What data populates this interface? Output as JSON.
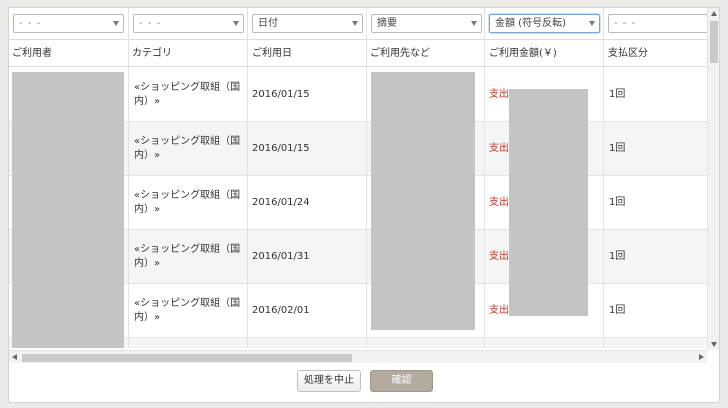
{
  "filters": [
    {
      "value": "- - -"
    },
    {
      "value": "- - -"
    },
    {
      "value": "日付"
    },
    {
      "value": "摘要"
    },
    {
      "value": "金額 (符号反転)"
    },
    {
      "value": "- - -"
    }
  ],
  "headers": [
    "ご利用者",
    "カテゴリ",
    "ご利用日",
    "ご利用先など",
    "ご利用金額(￥)",
    "支払区分"
  ],
  "rows": [
    {
      "category_line1": "«ショッピング取組（国",
      "category_line2": "内）»",
      "date": "2016/01/15",
      "type": "支出",
      "payment": "1回"
    },
    {
      "category_line1": "«ショッピング取組（国",
      "category_line2": "内）»",
      "date": "2016/01/15",
      "type": "支出",
      "payment": "1回"
    },
    {
      "category_line1": "«ショッピング取組（国",
      "category_line2": "内）»",
      "date": "2016/01/24",
      "type": "支出",
      "payment": "1回"
    },
    {
      "category_line1": "«ショッピング取組（国",
      "category_line2": "内）»",
      "date": "2016/01/31",
      "type": "支出",
      "payment": "1回"
    },
    {
      "category_line1": "«ショッピング取組（国",
      "category_line2": "内）»",
      "date": "2016/02/01",
      "type": "支出",
      "payment": "1回"
    }
  ],
  "buttons": {
    "cancel": "処理を中止",
    "confirm": "確認"
  },
  "colors": {
    "expense": "#c03a2b",
    "confirm_bg": "#b3ab9e",
    "active_filter_border": "#7aa6d6"
  }
}
